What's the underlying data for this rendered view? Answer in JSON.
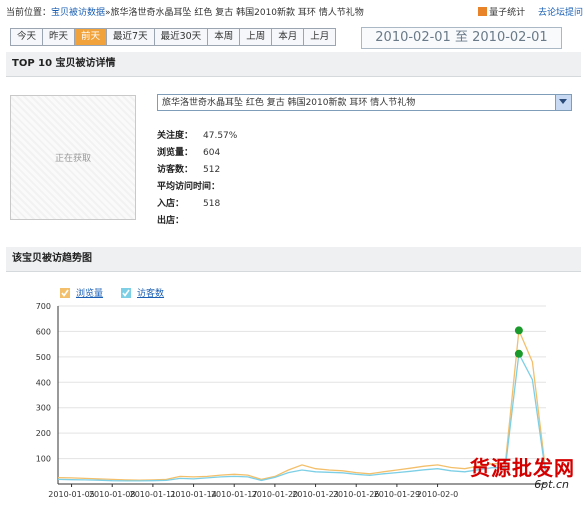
{
  "breadcrumb": {
    "label": "当前位置：",
    "link": "宝贝被访数据",
    "product": "»旅华洛世奇水晶耳坠 红色 复古 韩国2010新款 耳环 情人节礼物"
  },
  "header_links": {
    "stats": "量子统计",
    "forum": "去论坛提问"
  },
  "tabs": [
    {
      "label": "今天",
      "active": false
    },
    {
      "label": "昨天",
      "active": false
    },
    {
      "label": "前天",
      "active": true
    },
    {
      "label": "最近7天",
      "active": false
    },
    {
      "label": "最近30天",
      "active": false
    },
    {
      "label": "本周",
      "active": false
    },
    {
      "label": "上周",
      "active": false
    },
    {
      "label": "本月",
      "active": false
    },
    {
      "label": "上月",
      "active": false
    }
  ],
  "date_range": {
    "start": "2010-02-01",
    "sep": "至",
    "end": "2010-02-01"
  },
  "section1": {
    "title": "TOP 10 宝贝被访详情"
  },
  "thumbnail": {
    "text": "正在获取"
  },
  "product_select": {
    "value": "旅华洛世奇水晶耳坠 红色 复古 韩国2010新款 耳环 情人节礼物"
  },
  "stats": [
    {
      "key": "关注度：",
      "value": "47.57%"
    },
    {
      "key": "浏览量：",
      "value": "604"
    },
    {
      "key": "访客数：",
      "value": "512"
    },
    {
      "key": "平均访问时间：",
      "value": ""
    },
    {
      "key": "入店：",
      "value": "518"
    },
    {
      "key": "出店：",
      "value": ""
    }
  ],
  "section2": {
    "title": "该宝贝被访趋势图"
  },
  "watermark": {
    "main": "货源批发网",
    "sub": "6pt.cn"
  },
  "colors": {
    "pv": "#f3bf6a",
    "uv": "#7dcfe6",
    "marker": "#1a9a2a",
    "tab_active": "#f2a23a"
  },
  "chart_data": {
    "type": "line",
    "series": [
      {
        "name": "浏览量",
        "values": [
          25,
          24,
          22,
          20,
          18,
          16,
          15,
          16,
          18,
          30,
          28,
          30,
          35,
          38,
          35,
          18,
          30,
          55,
          75,
          60,
          55,
          52,
          45,
          40,
          48,
          55,
          62,
          70,
          75,
          65,
          60,
          70,
          80,
          80,
          604,
          480,
          40
        ]
      },
      {
        "name": "访客数",
        "values": [
          18,
          17,
          16,
          15,
          13,
          12,
          12,
          13,
          14,
          22,
          20,
          24,
          28,
          30,
          28,
          14,
          26,
          45,
          55,
          48,
          46,
          44,
          38,
          34,
          40,
          45,
          50,
          56,
          60,
          52,
          48,
          56,
          64,
          64,
          512,
          410,
          32
        ]
      }
    ],
    "x_ticks": [
      "2010-01-05",
      "2010-01-08",
      "2010-01-11",
      "2010-01-14",
      "2010-01-17",
      "2010-01-20",
      "2010-01-23",
      "2010-01-26",
      "2010-01-29",
      "2010-02-0"
    ],
    "y_ticks": [
      "100",
      "200",
      "300",
      "400",
      "500",
      "600",
      "700"
    ],
    "ylim": [
      0,
      700
    ],
    "grid": true,
    "legend": "top-left"
  }
}
